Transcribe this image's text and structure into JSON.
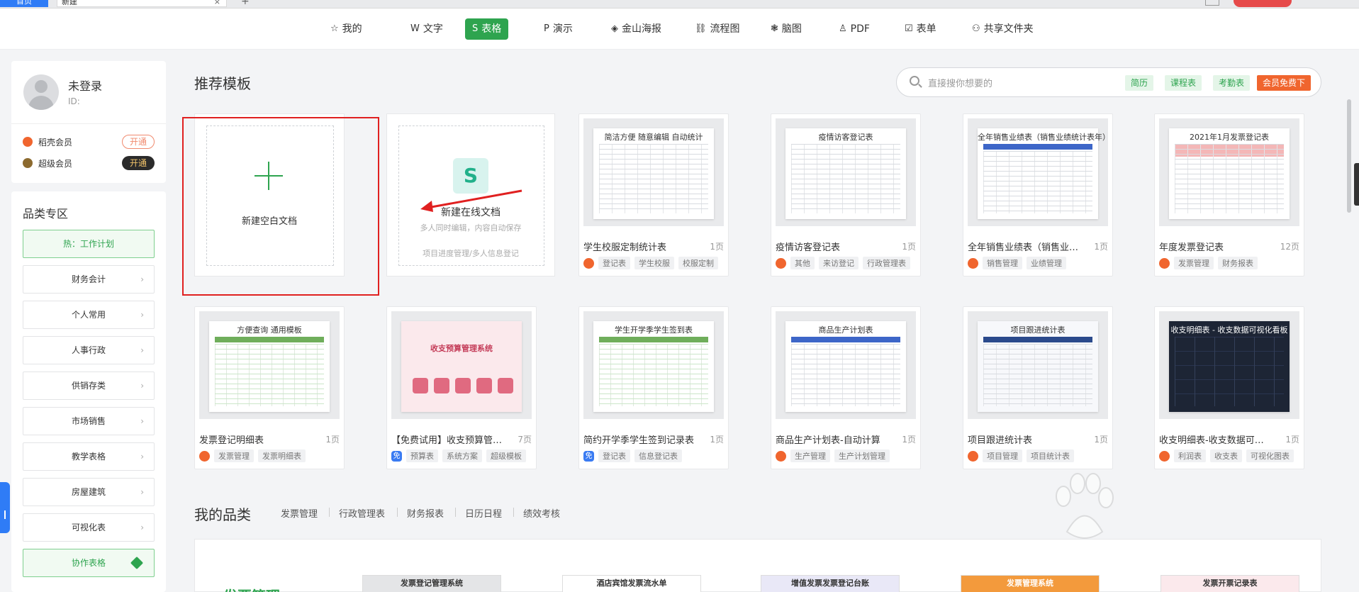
{
  "browser": {
    "tab1": "首页",
    "tab2": "新建",
    "close": "×",
    "newtab": "+"
  },
  "nav": {
    "items": [
      {
        "label": "我的",
        "icon": "☆"
      },
      {
        "label": "文字",
        "icon": "W"
      },
      {
        "label": "表格",
        "icon": "S",
        "active": true
      },
      {
        "label": "演示",
        "icon": "P"
      },
      {
        "label": "金山海报",
        "icon": "◈"
      },
      {
        "label": "流程图",
        "icon": "⛓"
      },
      {
        "label": "脑图",
        "icon": "❃"
      },
      {
        "label": "PDF",
        "icon": "♙"
      },
      {
        "label": "表单",
        "icon": "☑"
      },
      {
        "label": "共享文件夹",
        "icon": "⚇"
      }
    ]
  },
  "user": {
    "name": "未登录",
    "id_label": "ID:",
    "members": [
      {
        "label": "稻壳会员",
        "button": "开通",
        "icon_color": "#f0652e"
      },
      {
        "label": "超级会员",
        "button": "开通",
        "icon_color": "#8c6a2f"
      }
    ]
  },
  "categories": {
    "title": "品类专区",
    "hot": "热：工作计划",
    "items": [
      "财务会计",
      "个人常用",
      "人事行政",
      "供销存类",
      "市场销售",
      "教学表格",
      "房屋建筑",
      "可视化表"
    ],
    "collab": "协作表格",
    "chevron": "›"
  },
  "templates": {
    "title": "推荐模板",
    "search_placeholder": "直接搜你想要的",
    "search_tags": [
      "简历",
      "课程表",
      "考勤表"
    ],
    "vip_tag": "会员免费下",
    "blank": {
      "label": "新建空白文档"
    },
    "online": {
      "label": "新建在线文档",
      "sub": "多人同时编辑，内容自动保存",
      "sub2": "项目进度管理/多人信息登记"
    },
    "cards": [
      {
        "title": "学生校服定制统计表",
        "pages": "1页",
        "badge": "hot",
        "tags": [
          "登记表",
          "学生校服",
          "校服定制"
        ],
        "doc_title": "简洁方便 随意编辑 自动统计",
        "style": "plain"
      },
      {
        "title": "疫情访客登记表",
        "pages": "1页",
        "badge": "hot",
        "tags": [
          "其他",
          "来访登记",
          "行政管理表"
        ],
        "doc_title": "疫情访客登记表",
        "style": "plain"
      },
      {
        "title": "全年销售业绩表（销售业绩统...",
        "pages": "1页",
        "badge": "hot",
        "tags": [
          "销售管理",
          "业绩管理"
        ],
        "doc_title": "全年销售业绩表（销售业绩统计表年）",
        "style": "blue"
      },
      {
        "title": "年度发票登记表",
        "pages": "12页",
        "badge": "hot",
        "tags": [
          "发票管理",
          "财务报表"
        ],
        "doc_title": "2021年1月发票登记表",
        "style": "pink"
      },
      {
        "title": "发票登记明细表",
        "pages": "1页",
        "badge": "hot",
        "tags": [
          "发票管理",
          "发票明细表"
        ],
        "doc_title": "方便查询  通用模板",
        "style": "green"
      },
      {
        "title": "【免费试用】收支预算管理-超...",
        "pages": "7页",
        "badge": "free",
        "tags": [
          "预算表",
          "系统方案",
          "超级模板"
        ],
        "doc_title": "收支预算管理系统",
        "style": "budget"
      },
      {
        "title": "简约开学季学生签到记录表",
        "pages": "1页",
        "badge": "free",
        "tags": [
          "登记表",
          "信息登记表"
        ],
        "doc_title": "学生开学季学生签到表",
        "style": "green"
      },
      {
        "title": "商品生产计划表-自动计算",
        "pages": "1页",
        "badge": "hot",
        "tags": [
          "生产管理",
          "生产计划管理"
        ],
        "doc_title": "商品生产计划表",
        "style": "blue"
      },
      {
        "title": "项目跟进统计表",
        "pages": "1页",
        "badge": "hot",
        "tags": [
          "项目管理",
          "项目统计表"
        ],
        "doc_title": "项目跟进统计表",
        "style": "navy"
      },
      {
        "title": "收支明细表-收支数据可视化看...",
        "pages": "1页",
        "badge": "hot",
        "tags": [
          "利润表",
          "收支表",
          "可视化图表"
        ],
        "doc_title": "收支明细表 - 收支数据可视化看板",
        "style": "dark"
      }
    ]
  },
  "my_categories": {
    "title": "我的品类",
    "tabs": [
      "发票管理",
      "行政管理表",
      "财务报表",
      "日历日程",
      "绩效考核"
    ],
    "heading": "发票管理",
    "minis": [
      "发票登记管理系统",
      "酒店宾馆发票流水单",
      "增值发票发票登记台账",
      "发票管理系统",
      "发票开票记录表"
    ]
  },
  "colors": {
    "accent": "#2ea44f",
    "vip": "#f0652e",
    "highlight": "#e02020"
  }
}
